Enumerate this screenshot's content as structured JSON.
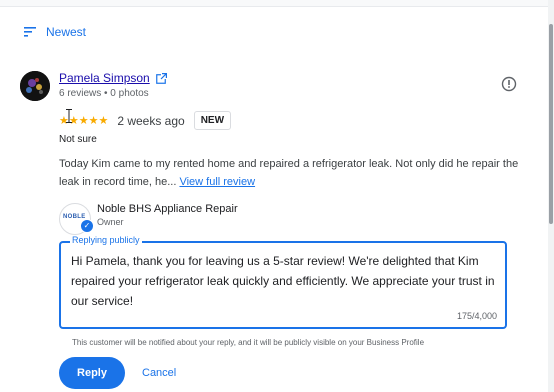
{
  "sort": {
    "label": "Newest",
    "icon": "sort-icon"
  },
  "review": {
    "reviewer_name": "Pamela Simpson",
    "reviewer_meta": "6 reviews • 0 photos",
    "stars": "★★★★★",
    "time_ago": "2 weeks ago",
    "badge": "NEW",
    "tag": "Not sure",
    "text": "Today Kim came to my rented home and repaired a refrigerator leak. Not only did he repair the leak in record time, he...",
    "view_full_label": "View full review"
  },
  "business": {
    "name": "Noble BHS Appliance Repair",
    "role": "Owner",
    "logo_text": "NOBLE",
    "verified_mark": "✓"
  },
  "reply": {
    "label": "Replying publicly",
    "text": "Hi Pamela, thank you for leaving us a 5-star review! We're delighted that Kim repaired your refrigerator leak quickly and efficiently. We appreciate your trust in our service!",
    "counter": "175/4,000",
    "notice": "This customer will be notified about your reply, and it will be publicly visible on your Business Profile",
    "reply_button": "Reply",
    "cancel_button": "Cancel"
  },
  "colors": {
    "accent": "#1a73e8",
    "star": "#f9ab00",
    "link": "#1a0dab"
  }
}
